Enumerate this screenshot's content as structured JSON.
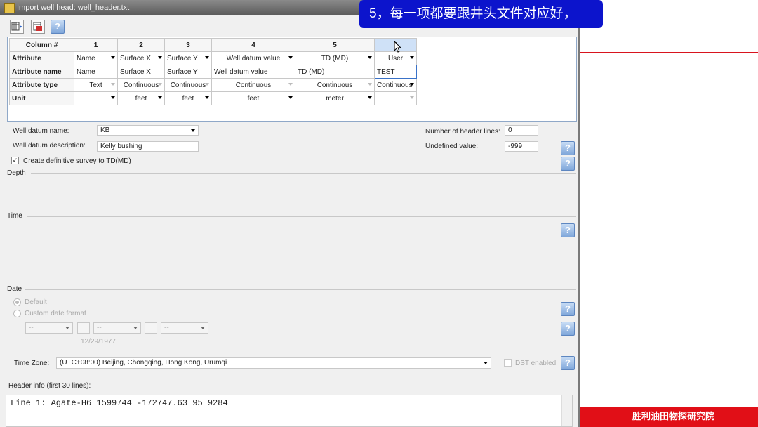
{
  "window": {
    "title": "Import well head: well_header.txt"
  },
  "callout": {
    "text": "5，每一项都要跟井头文件对应好，"
  },
  "footer": {
    "text": "胜利油田物探研究院"
  },
  "grid": {
    "corner": "Column #",
    "columns": [
      "1",
      "2",
      "3",
      "4",
      "5",
      "6"
    ],
    "rows": [
      {
        "header": "Attribute",
        "cells": [
          "Name",
          "Surface X",
          "Surface Y",
          "Well datum value",
          "TD (MD)",
          "User"
        ]
      },
      {
        "header": "Attribute name",
        "cells": [
          "Name",
          "Surface X",
          "Surface Y",
          "Well datum value",
          "TD (MD)",
          "TEST"
        ]
      },
      {
        "header": "Attribute type",
        "cells": [
          "Text",
          "Continuous",
          "Continuous",
          "Continuous",
          "Continuous",
          "Continuous"
        ]
      },
      {
        "header": "Unit",
        "cells": [
          "",
          "feet",
          "feet",
          "feet",
          "meter",
          ""
        ]
      }
    ]
  },
  "form": {
    "well_datum_name_label": "Well datum name:",
    "well_datum_name_value": "KB",
    "well_datum_desc_label": "Well datum description:",
    "well_datum_desc_value": "Kelly bushing",
    "header_lines_label": "Number of header lines:",
    "header_lines_value": "0",
    "undefined_label": "Undefined value:",
    "undefined_value": "-999",
    "definitive_survey_label": "Create definitive survey to TD(MD)",
    "definitive_survey_checked": true
  },
  "sections": {
    "depth": "Depth",
    "time": "Time",
    "date": "Date"
  },
  "date": {
    "default_label": "Default",
    "custom_label": "Custom date format",
    "select1": "--",
    "select2": "--",
    "select3": "--",
    "example": "12/29/1977"
  },
  "timezone": {
    "label": "Time Zone:",
    "value": "(UTC+08:00) Beijing, Chongqing, Hong Kong, Urumqi",
    "dst_label": "DST enabled"
  },
  "header_info": {
    "label": "Header info (first 30 lines):",
    "line1": "Line  1: Agate-H6 1599744 -172747.63 95 9284"
  },
  "help_icon_text": "?"
}
